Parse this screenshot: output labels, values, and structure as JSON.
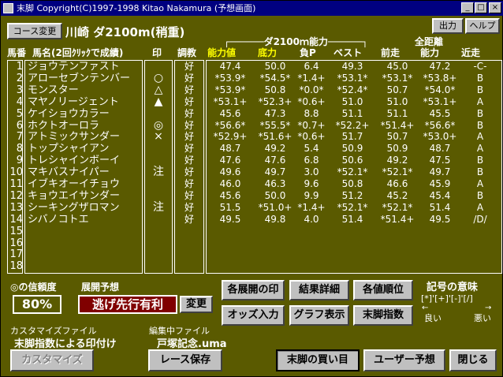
{
  "window": {
    "title": "末脚  Copyright(C)1997-1998 Kitao Nakamura (予想画面)",
    "min_glyph": "_",
    "max_glyph": "□",
    "close_glyph": "×"
  },
  "toolbar": {
    "course_change": "コース変更",
    "output": "出力",
    "help": "ヘルプ"
  },
  "race": {
    "header": "川崎 ダ2100m(稍重)"
  },
  "table": {
    "headers": {
      "horse_no": "馬番",
      "horse_name": "馬名(2回ｸﾘｯｸで成績)",
      "mark": "印",
      "condition": "調教",
      "ability": "能力値",
      "base": "底力",
      "negP": "負P",
      "best": "ベスト",
      "prev": "前走",
      "all_dist": "全距離",
      "all_ability": "能力",
      "recent": "近走",
      "group": "ダ2100ｍ能力"
    },
    "rows": [
      {
        "no": "1",
        "name": "ジョウテンファスト",
        "mark": "",
        "cond": "好",
        "ability": "47.4",
        "base": "50.0",
        "negP": "6.4",
        "best": "49.3",
        "prev": "45.0",
        "all": "47.2",
        "recent": "-C-"
      },
      {
        "no": "2",
        "name": "アローセブンテンバー",
        "mark": "○",
        "cond": "好",
        "ability": "*53.9*",
        "base": "*54.5*",
        "negP": "*1.4+",
        "best": "*53.1*",
        "prev": "*53.1*",
        "all": "*53.8+",
        "recent": "B"
      },
      {
        "no": "3",
        "name": "モンスター",
        "mark": "△",
        "cond": "好",
        "ability": "*53.9*",
        "base": "50.8",
        "negP": "*0.0*",
        "best": "*52.4*",
        "prev": "50.7",
        "all": "*54.0*",
        "recent": "B"
      },
      {
        "no": "4",
        "name": "マヤノリージェント",
        "mark": "▲",
        "cond": "好",
        "ability": "*53.1+",
        "base": "*52.3+",
        "negP": "*0.6+",
        "best": "51.0",
        "prev": "51.0",
        "all": "*53.1+",
        "recent": "A"
      },
      {
        "no": "5",
        "name": "ケイショウカラー",
        "mark": "",
        "cond": "好",
        "ability": "45.6",
        "base": "47.3",
        "negP": "8.8",
        "best": "51.1",
        "prev": "51.1",
        "all": "45.5",
        "recent": "B"
      },
      {
        "no": "6",
        "name": "ホクトオーロラ",
        "mark": "◎",
        "cond": "好",
        "ability": "*56.6*",
        "base": "*55.5*",
        "negP": "*0.7+",
        "best": "*52.2+",
        "prev": "*51.4+",
        "all": "*56.6*",
        "recent": "B"
      },
      {
        "no": "7",
        "name": "アトミックサンダー",
        "mark": "×",
        "cond": "好",
        "ability": "*52.9+",
        "base": "*51.6+",
        "negP": "*0.6+",
        "best": "51.7",
        "prev": "50.7",
        "all": "*53.0+",
        "recent": "A"
      },
      {
        "no": "8",
        "name": "トップシャイアン",
        "mark": "",
        "cond": "好",
        "ability": "48.7",
        "base": "49.2",
        "negP": "5.4",
        "best": "50.9",
        "prev": "50.9",
        "all": "48.7",
        "recent": "A"
      },
      {
        "no": "9",
        "name": "トレシャインボーイ",
        "mark": "",
        "cond": "好",
        "ability": "47.6",
        "base": "47.6",
        "negP": "6.8",
        "best": "50.6",
        "prev": "49.2",
        "all": "47.5",
        "recent": "B"
      },
      {
        "no": "10",
        "name": "マキバスナイパー",
        "mark": "注",
        "cond": "好",
        "ability": "49.6",
        "base": "49.7",
        "negP": "3.0",
        "best": "*52.1*",
        "prev": "*52.1*",
        "all": "49.7",
        "recent": "B"
      },
      {
        "no": "11",
        "name": "イブキオーイチョウ",
        "mark": "",
        "cond": "好",
        "ability": "46.0",
        "base": "46.3",
        "negP": "9.6",
        "best": "50.8",
        "prev": "46.6",
        "all": "45.9",
        "recent": "A"
      },
      {
        "no": "12",
        "name": "キョウエイサンダー",
        "mark": "",
        "cond": "好",
        "ability": "45.6",
        "base": "50.0",
        "negP": "9.9",
        "best": "51.2",
        "prev": "45.2",
        "all": "45.4",
        "recent": "B"
      },
      {
        "no": "13",
        "name": "シーキングザロマン",
        "mark": "注",
        "cond": "好",
        "ability": "51.5",
        "base": "*51.0+",
        "negP": "*1.4+",
        "best": "*52.1*",
        "prev": "*52.1*",
        "all": "51.4",
        "recent": "A"
      },
      {
        "no": "14",
        "name": "シバノコトエ",
        "mark": "",
        "cond": "好",
        "ability": "49.5",
        "base": "49.8",
        "negP": "4.0",
        "best": "51.4",
        "prev": "*51.4+",
        "all": "49.5",
        "recent": "/D/"
      },
      {
        "no": "15",
        "name": "",
        "mark": "",
        "cond": "",
        "ability": "",
        "base": "",
        "negP": "",
        "best": "",
        "prev": "",
        "all": "",
        "recent": ""
      },
      {
        "no": "16",
        "name": "",
        "mark": "",
        "cond": "",
        "ability": "",
        "base": "",
        "negP": "",
        "best": "",
        "prev": "",
        "all": "",
        "recent": ""
      },
      {
        "no": "17",
        "name": "",
        "mark": "",
        "cond": "",
        "ability": "",
        "base": "",
        "negP": "",
        "best": "",
        "prev": "",
        "all": "",
        "recent": ""
      },
      {
        "no": "18",
        "name": "",
        "mark": "",
        "cond": "",
        "ability": "",
        "base": "",
        "negP": "",
        "best": "",
        "prev": "",
        "all": "",
        "recent": ""
      }
    ]
  },
  "bottom": {
    "reliability_label": "◎の信頼度",
    "reliability_value": "80%",
    "forecast_label": "展開予想",
    "forecast_value": "逃げ先行有利",
    "change": "変更",
    "marks_by_pace": "各展開の印",
    "result_detail": "結果詳細",
    "value_rank": "各値順位",
    "odds_input": "オッズ入力",
    "graph_view": "グラフ表示",
    "suekyaku_index": "末脚指数",
    "legend_title": "記号の意味",
    "legend_symbols": "[*]'[+]'[-]'[/]",
    "legend_good": "良い",
    "legend_bad": "悪い",
    "customize_file_label": "カスタマイズファイル",
    "customize_file_value": "末脚指数による印付け",
    "editing_file_label": "編集中ファイル",
    "editing_file_value": "戸塚記念.uma",
    "customize": "カスタマイズ",
    "race_save": "レース保存",
    "buy": "末脚の買い目",
    "user_forecast": "ユーザー予想",
    "close": "閉じる"
  }
}
